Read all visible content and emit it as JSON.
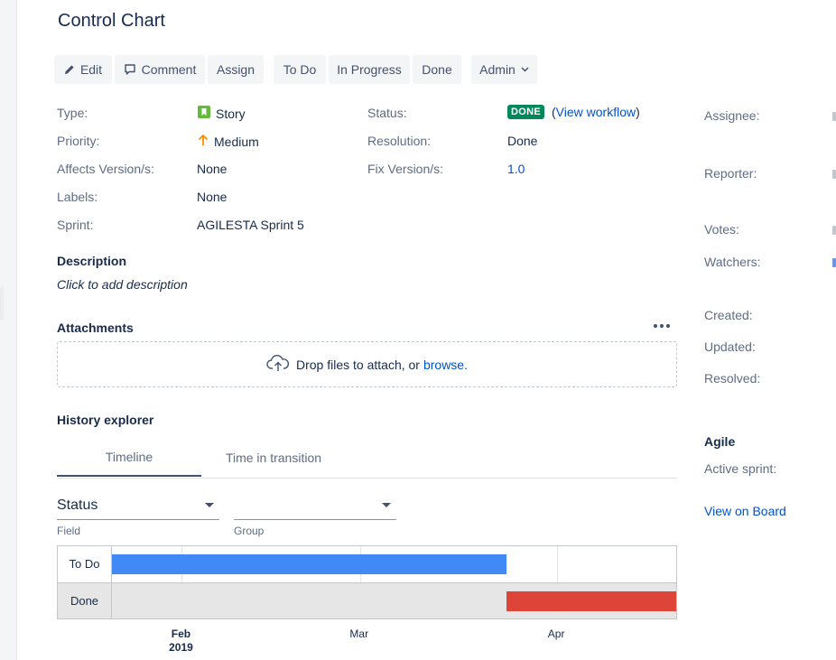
{
  "page": {
    "title": "Control Chart"
  },
  "toolbar": {
    "edit": "Edit",
    "comment": "Comment",
    "assign": "Assign",
    "todo": "To Do",
    "in_progress": "In Progress",
    "done": "Done",
    "admin": "Admin"
  },
  "details": {
    "type_label": "Type:",
    "type_value": "Story",
    "priority_label": "Priority:",
    "priority_value": "Medium",
    "affects_label": "Affects Version/s:",
    "affects_value": "None",
    "labels_label": "Labels:",
    "labels_value": "None",
    "sprint_label": "Sprint:",
    "sprint_value": "AGILESTA Sprint 5",
    "status_label": "Status:",
    "status_value": "DONE",
    "view_workflow_open": "(",
    "view_workflow": "View workflow",
    "view_workflow_close": ")",
    "resolution_label": "Resolution:",
    "resolution_value": "Done",
    "fix_label": "Fix Version/s:",
    "fix_value": "1.0"
  },
  "description": {
    "heading": "Description",
    "placeholder": "Click to add description"
  },
  "attachments": {
    "heading": "Attachments",
    "drop_text": "Drop files to attach, or",
    "browse": "browse."
  },
  "history": {
    "heading": "History explorer",
    "tabs": [
      "Timeline",
      "Time in transition"
    ],
    "field_select": {
      "value": "Status",
      "hint": "Field"
    },
    "group_select": {
      "value": "",
      "hint": "Group"
    }
  },
  "chart_data": {
    "type": "bar",
    "orientation": "horizontal-timeline",
    "rows": [
      "To Do",
      "Done"
    ],
    "x_ticks": [
      {
        "label": "Feb",
        "sub": "2019",
        "date": "2019-02-01"
      },
      {
        "label": "Mar",
        "sub": "",
        "date": "2019-03-01"
      },
      {
        "label": "Apr",
        "sub": "",
        "date": "2019-04-01"
      }
    ],
    "xlim": [
      "2019-01-21",
      "2019-04-20"
    ],
    "series": [
      {
        "row": "To Do",
        "start": "2019-01-21",
        "end": "2019-03-24",
        "color": "#4189f4"
      },
      {
        "row": "Done",
        "start": "2019-03-24",
        "end": "2019-04-20",
        "color": "#de4437"
      }
    ],
    "grid": true
  },
  "right_panel": {
    "assignee_label": "Assignee:",
    "reporter_label": "Reporter:",
    "votes_label": "Votes:",
    "watchers_label": "Watchers:",
    "created_label": "Created:",
    "updated_label": "Updated:",
    "resolved_label": "Resolved:",
    "agile_heading": "Agile",
    "active_sprint_label": "Active sprint:",
    "view_on_board": "View on Board"
  },
  "colors": {
    "accent": "#0052cc",
    "done_lozenge": "#00875a",
    "story_icon": "#63ba3c",
    "priority_medium": "#ff8b00"
  }
}
